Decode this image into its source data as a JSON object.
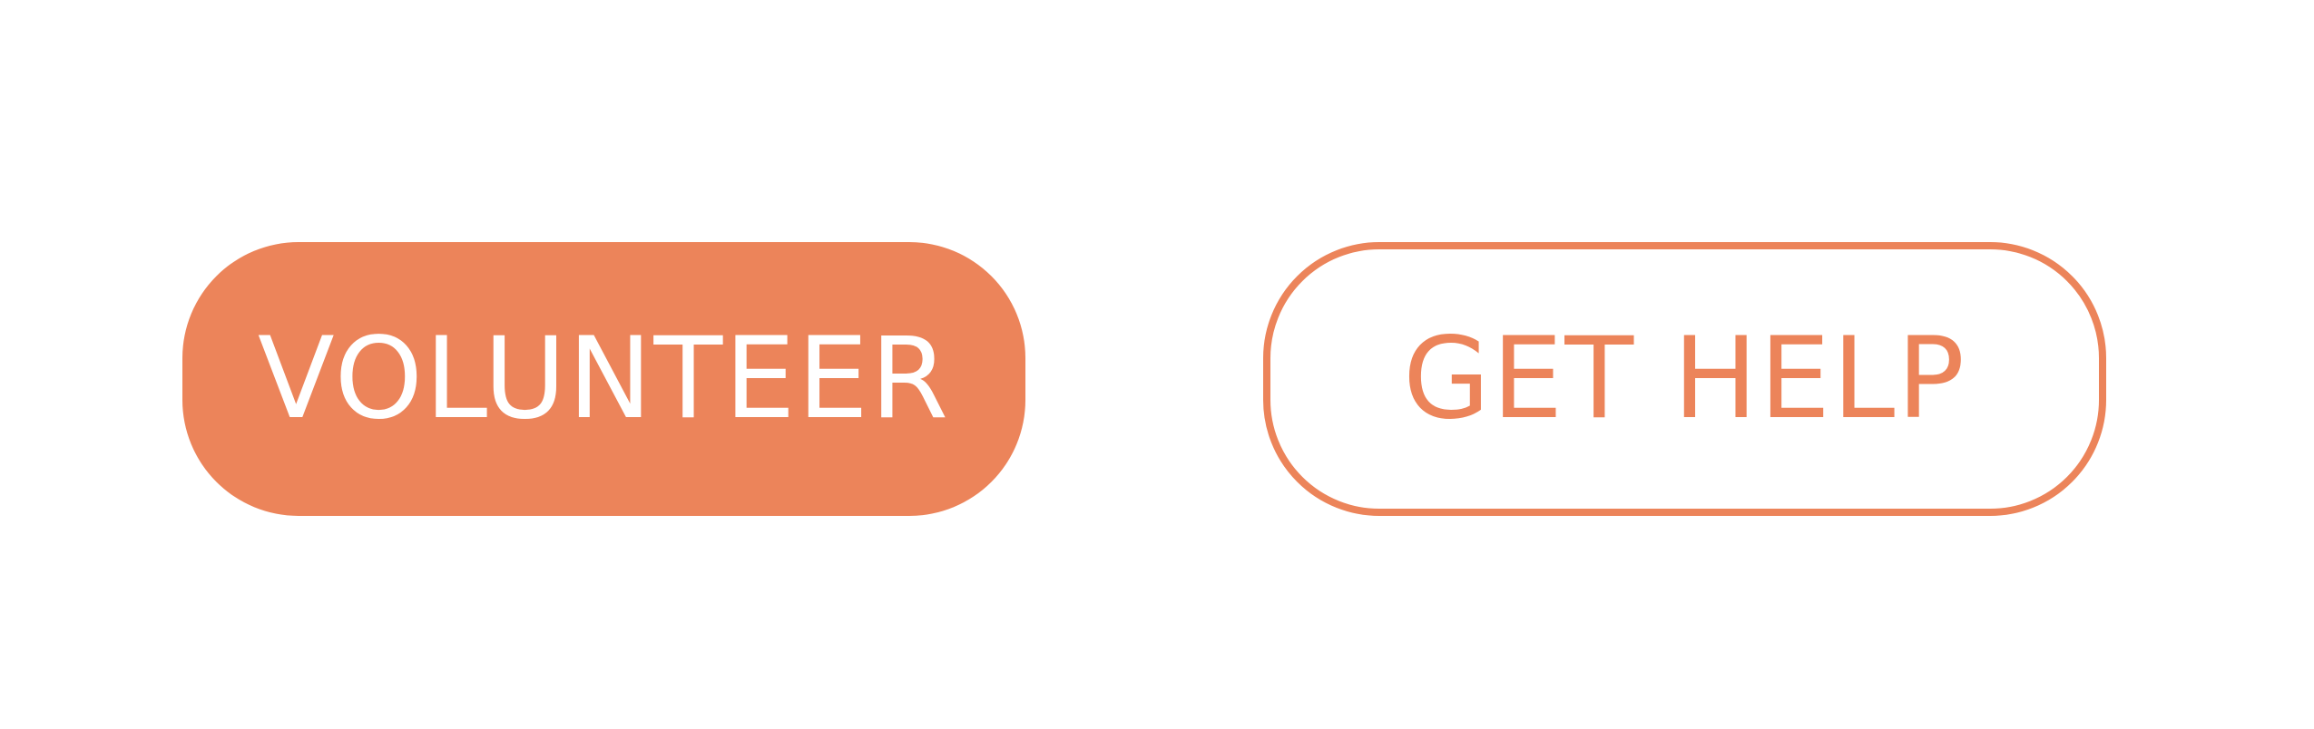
{
  "colors": {
    "accent": "#EC845A",
    "background": "#FFFFFF",
    "on_accent": "#FFFFFF"
  },
  "buttons": {
    "volunteer": {
      "label": "VOLUNTEER"
    },
    "get_help": {
      "label": "GET HELP"
    }
  }
}
